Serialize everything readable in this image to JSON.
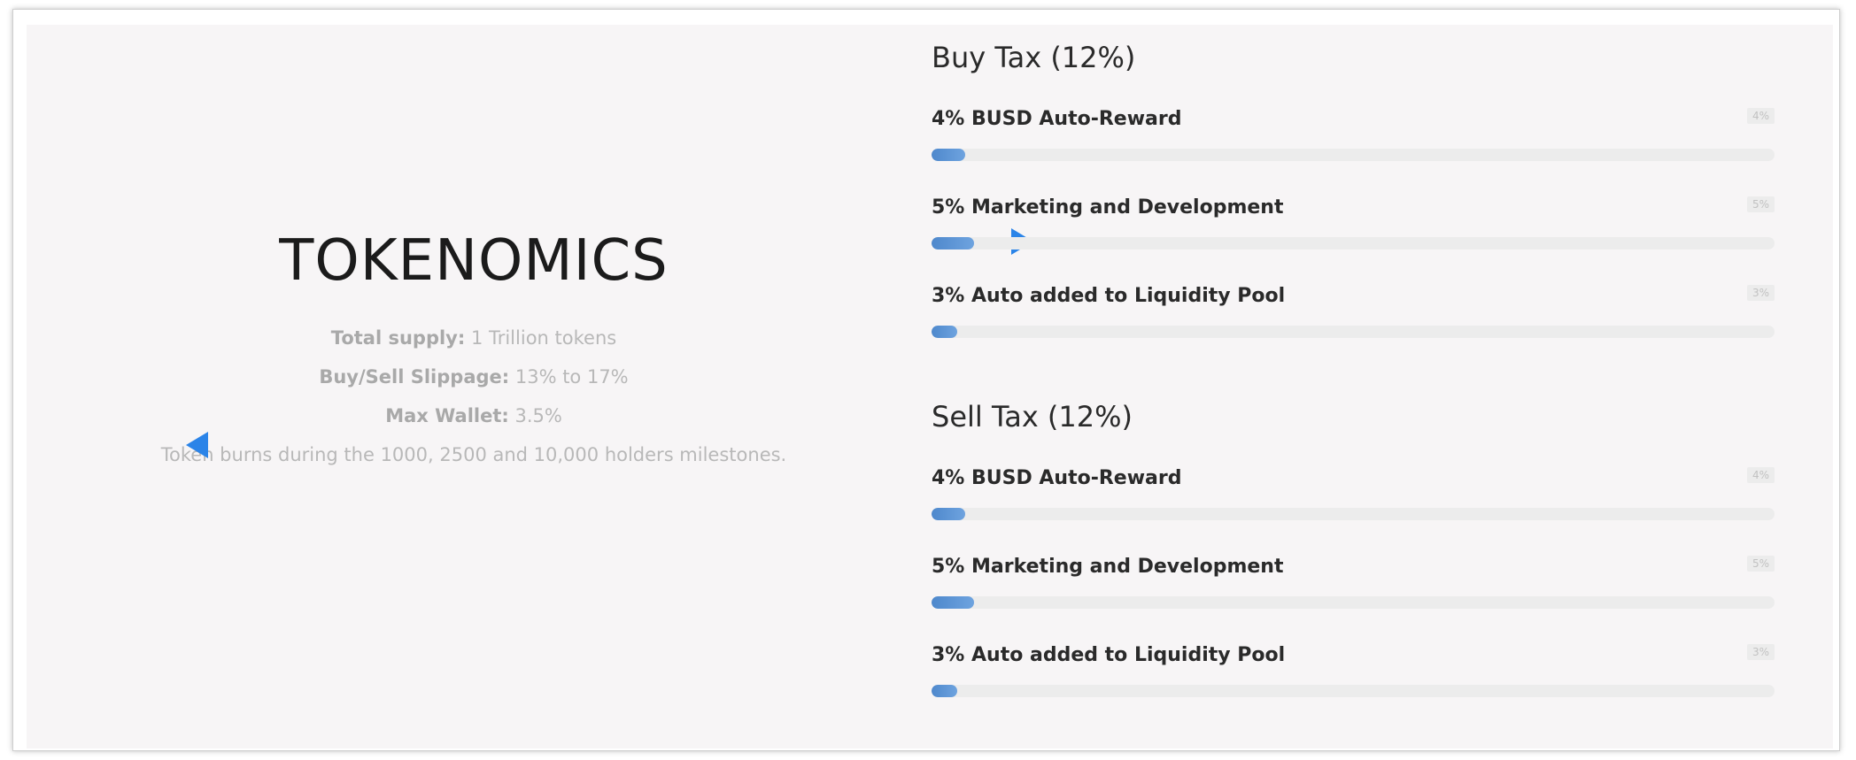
{
  "tokenomics": {
    "title": "TOKENOMICS",
    "total_supply_label": "Total supply:",
    "total_supply_value": " 1 Trillion tokens",
    "slippage_label": "Buy/Sell Slippage:",
    "slippage_value": " 13% to 17%",
    "max_wallet_label": "Max Wallet:",
    "max_wallet_value": " 3.5%",
    "burns_text": "Token burns during the 1000, 2500 and 10,000 holders milestones."
  },
  "buy_tax": {
    "title": "Buy Tax (12%)",
    "items": [
      {
        "label": "4% BUSD Auto-Reward",
        "badge": "4%",
        "percent": 4
      },
      {
        "label": "5% Marketing and Development",
        "badge": "5%",
        "percent": 5
      },
      {
        "label": "3% Auto added to Liquidity Pool",
        "badge": "3%",
        "percent": 3
      }
    ]
  },
  "sell_tax": {
    "title": "Sell Tax (12%)",
    "items": [
      {
        "label": "4% BUSD Auto-Reward",
        "badge": "4%",
        "percent": 4
      },
      {
        "label": "5% Marketing and Development",
        "badge": "5%",
        "percent": 5
      },
      {
        "label": "3% Auto added to Liquidity Pool",
        "badge": "3%",
        "percent": 3
      }
    ]
  },
  "colors": {
    "accent": "#2b84e8",
    "bar_fill": "#5a93d4",
    "bar_track": "#ececec",
    "panel_bg": "#f7f5f6"
  },
  "icons": {
    "left_arrow": "triangle-right-icon",
    "right_arrow": "triangle-left-icon"
  }
}
